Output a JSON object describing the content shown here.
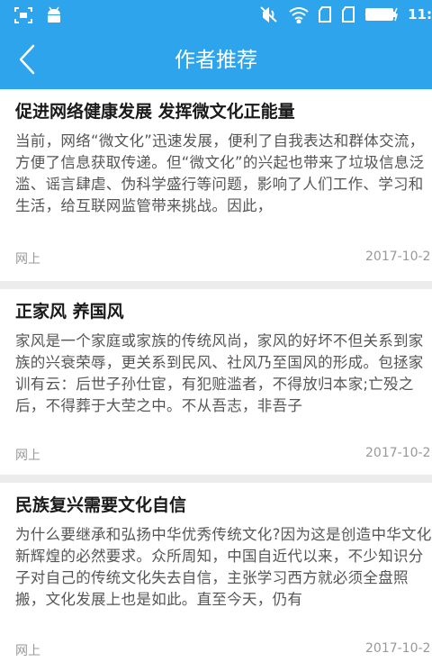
{
  "status": {
    "time": "11:"
  },
  "header": {
    "title": "作者推荐"
  },
  "articles": [
    {
      "title": "促进网络健康发展 发挥微文化正能量",
      "summary": "当前，网络“微文化”迅速发展，便利了自我表达和群体交流，方便了信息获取传递。但“微文化”的兴起也带来了垃圾信息泛滥、谣言肆虐、伪科学盛行等问题，影响了人们工作、学习和生活，给互联网监管带来挑战。因此，",
      "source": "网上",
      "date": "2017-10-2"
    },
    {
      "title": "正家风 养国风",
      "summary": "家风是一个家庭或家族的传统风尚，家风的好坏不但关系到家族的兴衰荣辱，更关系到民风、社风乃至国风的形成。包拯家训有云：后世子孙仕宦，有犯赃滥者，不得放归本家;亡殁之后，不得葬于大茔之中。不从吾志，非吾子",
      "source": "网上",
      "date": "2017-10-2"
    },
    {
      "title": "民族复兴需要文化自信",
      "summary": "为什么要继承和弘扬中华优秀传统文化?因为这是创造中华文化新辉煌的必然要求。众所周知，中国自近代以来，不少知识分子对自己的传统文化失去自信，主张学习西方就必须全盘照搬，文化发展上也是如此。直至今天，仍有",
      "source": "网上",
      "date": "2017-10-2"
    }
  ]
}
